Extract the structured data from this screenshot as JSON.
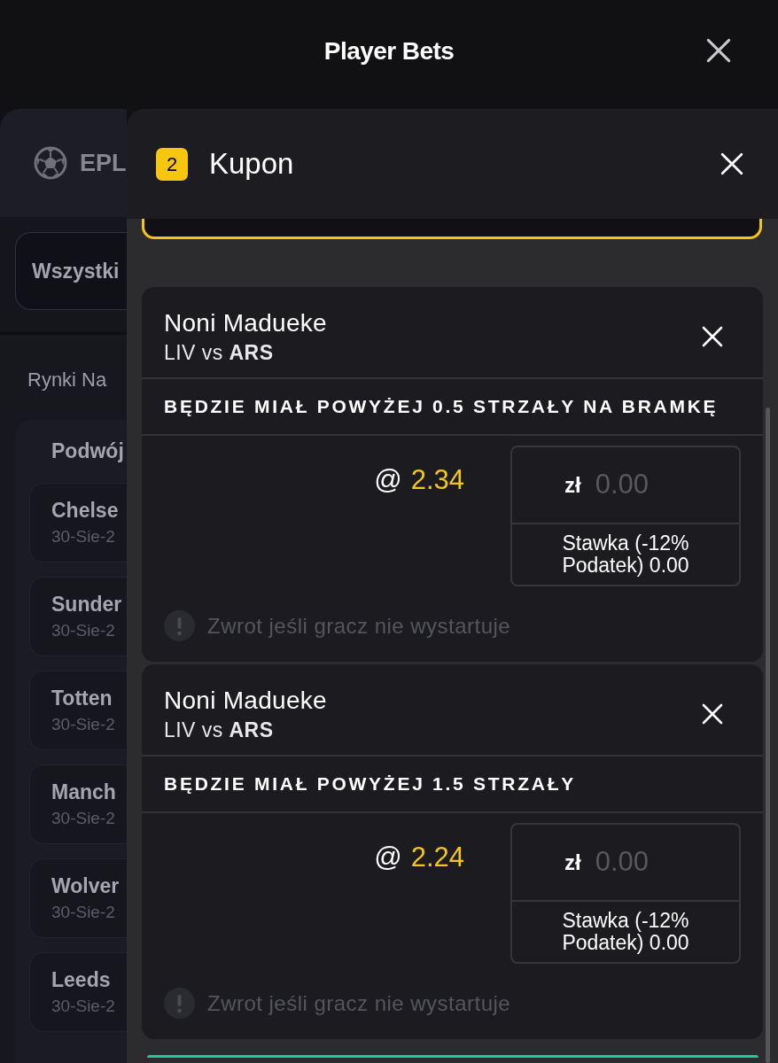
{
  "header": {
    "title": "Player Bets"
  },
  "sidebar": {
    "league": "EPL",
    "filter": "Wszystki",
    "section_title": "Rynki Na",
    "group": {
      "title": "Podwój",
      "matches": [
        {
          "name": "Chelse",
          "date": "30-Sie-2"
        },
        {
          "name": "Sunder",
          "date": "30-Sie-2"
        },
        {
          "name": "Totten",
          "date": "30-Sie-2"
        },
        {
          "name": "Manch",
          "date": "30-Sie-2"
        },
        {
          "name": "Wolver",
          "date": "30-Sie-2"
        },
        {
          "name": "Leeds",
          "date": "30-Sie-2"
        }
      ]
    }
  },
  "betslip": {
    "count": "2",
    "title": "Kupon",
    "bets": [
      {
        "player": "Noni Madueke",
        "match": "LIV vs **ARS**",
        "market": "BĘDZIE MIAŁ POWYŻEJ 0.5 STRZAŁY NA BRAMKĘ",
        "odds_prefix": "@",
        "odds": "2.34",
        "stake": {
          "currency": "zł",
          "placeholder": "0.00"
        },
        "tax_note": "Stawka (-12% Podatek) 0.00",
        "refund": {
          "label": "Zwrot jeśli gracz nie wystartuje",
          "disabled": true
        }
      },
      {
        "player": "Noni Madueke",
        "match": "LIV vs **ARS**",
        "market": "BĘDZIE MIAŁ POWYŻEJ 1.5 STRZAŁY",
        "odds_prefix": "@",
        "odds": "2.24",
        "stake": {
          "currency": "zł",
          "placeholder": "0.00"
        },
        "tax_note": "Stawka (-12% Podatek) 0.00",
        "refund": {
          "label": "Zwrot jeśli gracz nie wystartuje",
          "disabled": true
        }
      }
    ]
  }
}
